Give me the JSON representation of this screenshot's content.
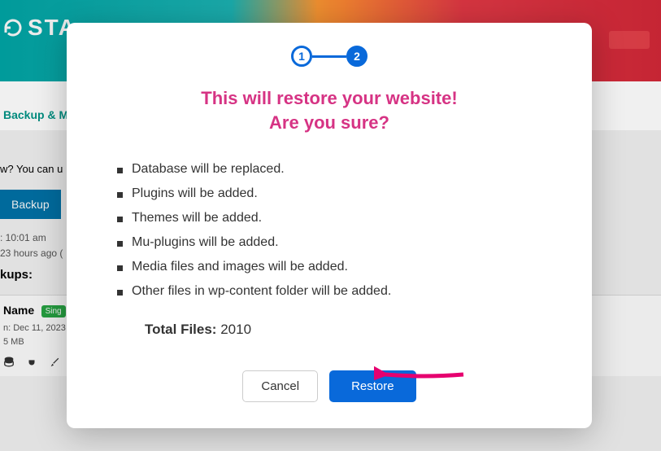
{
  "background": {
    "brand": "STA",
    "tab": "Backup & Mi",
    "promo": "w? You can u",
    "backup_btn": "Backup",
    "meta_time": ": 10:01 am",
    "meta_ago": "23 hours ago (",
    "kups": "kups:",
    "row_name": "Name",
    "row_badge": "Sing",
    "row_date": "n: Dec 11, 2023",
    "row_size": "5 MB"
  },
  "modal": {
    "step1": "1",
    "step2": "2",
    "title_line1": "This will restore your website!",
    "title_line2": "Are you sure?",
    "items": [
      "Database will be replaced.",
      "Plugins will be added.",
      "Themes will be added.",
      "Mu-plugins will be added.",
      "Media files and images will be added.",
      "Other files in wp-content folder will be added."
    ],
    "total_label": "Total Files:",
    "total_value": "2010",
    "cancel": "Cancel",
    "restore": "Restore"
  }
}
